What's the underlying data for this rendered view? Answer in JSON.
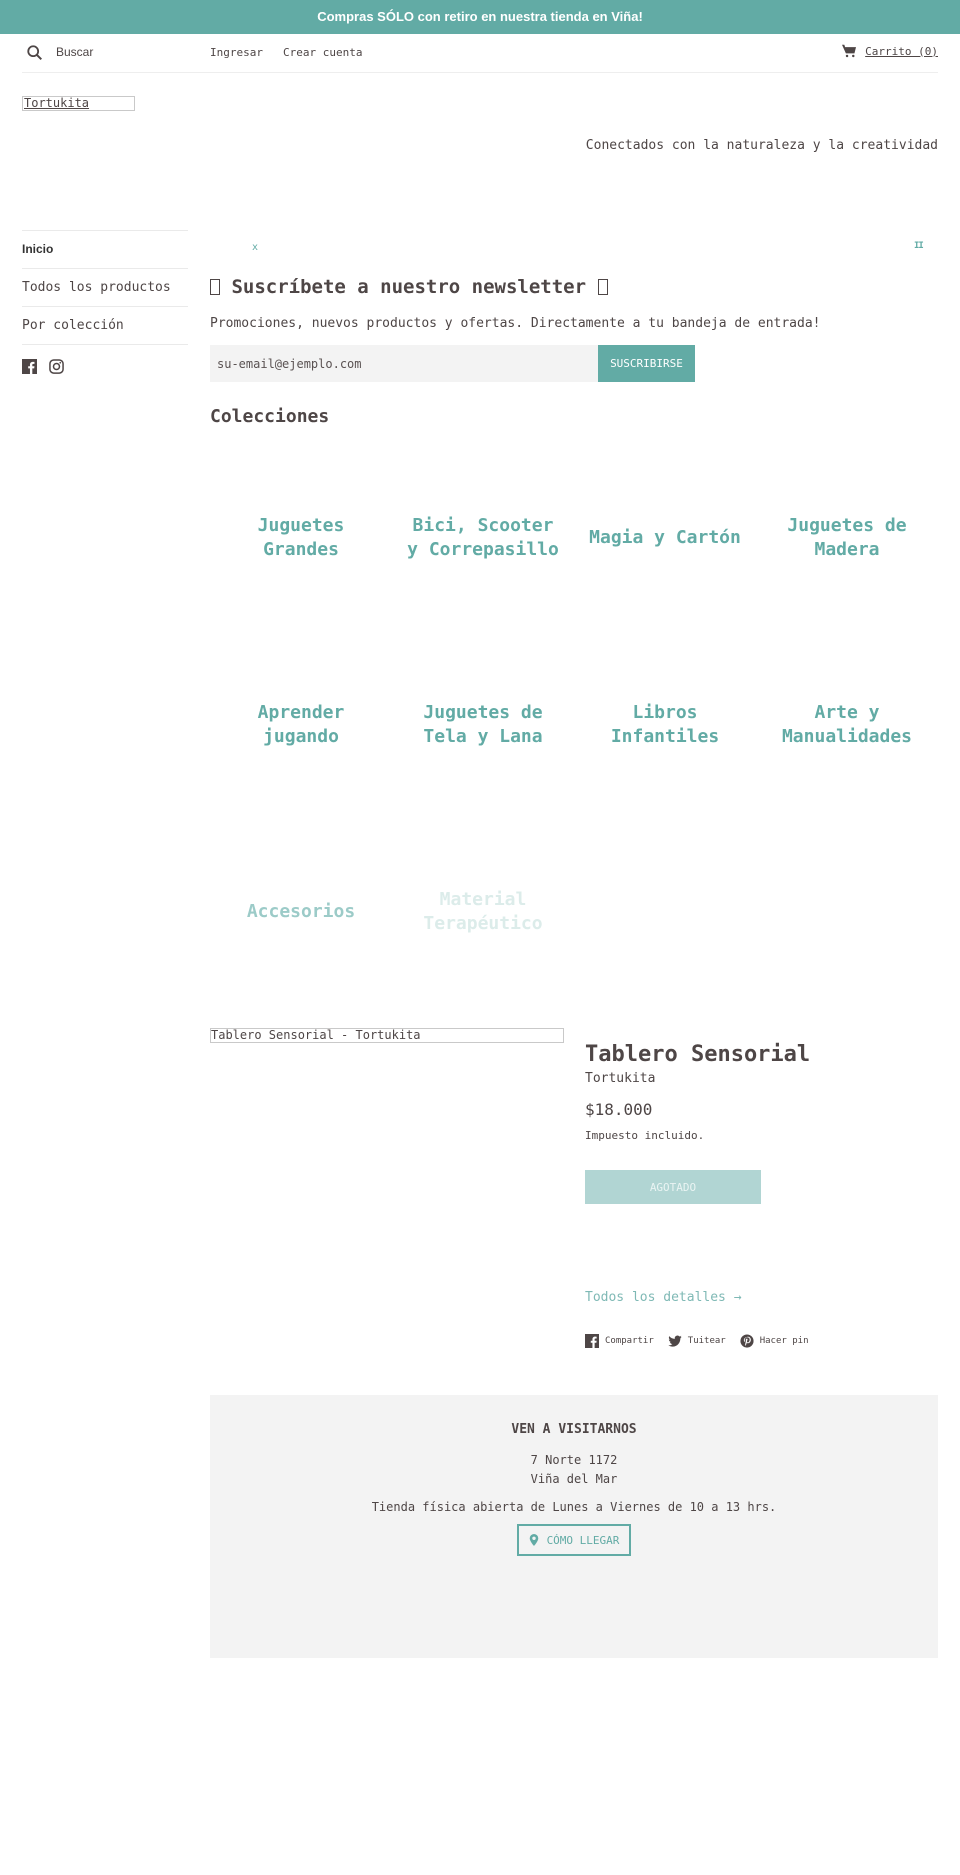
{
  "announcement": "Compras SÓLO con retiro en nuestra tienda en Viña!",
  "header": {
    "search_placeholder": "Buscar",
    "login": "Ingresar",
    "register": "Crear cuenta",
    "cart": "Carrito (0)"
  },
  "logo_alt": "Tortukita",
  "tagline": "Conectados con la naturaleza y la creatividad",
  "sidebar": {
    "items": [
      {
        "label": "Inicio"
      },
      {
        "label": "Todos los productos"
      },
      {
        "label": "Por colección"
      }
    ],
    "social": [
      "facebook-icon",
      "instagram-icon"
    ]
  },
  "slideshow": {
    "prev_glyph": "x",
    "pause_glyph": "II"
  },
  "newsletter": {
    "title": "Suscríbete a nuestro newsletter",
    "description": "Promociones, nuevos productos y ofertas. Directamente a tu bandeja de entrada!",
    "email_placeholder": "su-email@ejemplo.com",
    "button": "SUSCRIBIRSE"
  },
  "collections": {
    "title": "Colecciones",
    "items": [
      {
        "label": "Juguetes Grandes"
      },
      {
        "label": "Bici, Scooter y Correpasillo"
      },
      {
        "label": "Magia y Cartón"
      },
      {
        "label": "Juguetes de Madera"
      },
      {
        "label": "Aprender jugando"
      },
      {
        "label": "Juguetes de Tela y Lana"
      },
      {
        "label": "Libros Infantiles"
      },
      {
        "label": "Arte y Manualidades"
      },
      {
        "label": "Accesorios"
      },
      {
        "label": "Material Terapéutico"
      }
    ]
  },
  "product": {
    "image_alt": "Tablero Sensorial - Tortukita",
    "title": "Tablero Sensorial",
    "vendor": "Tortukita",
    "price": "$18.000",
    "tax_note": "Impuesto incluido.",
    "button": "AGOTADO",
    "details_link": "Todos los detalles →",
    "share": {
      "facebook": "Compartir",
      "twitter": "Tuitear",
      "pinterest": "Hacer pin"
    }
  },
  "visit": {
    "title": "VEN A VISITARNOS",
    "address_line1": "7 Norte 1172",
    "address_line2": "Viña del Mar",
    "hours": "Tienda física abierta de Lunes a Viernes de 10 a 13 hrs.",
    "button": "CÓMO LLEGAR"
  },
  "colors": {
    "accent": "#62aba5",
    "text": "#4e4646",
    "panel_bg": "#f3f3f3",
    "disabled_button": "#b1d5d3"
  }
}
